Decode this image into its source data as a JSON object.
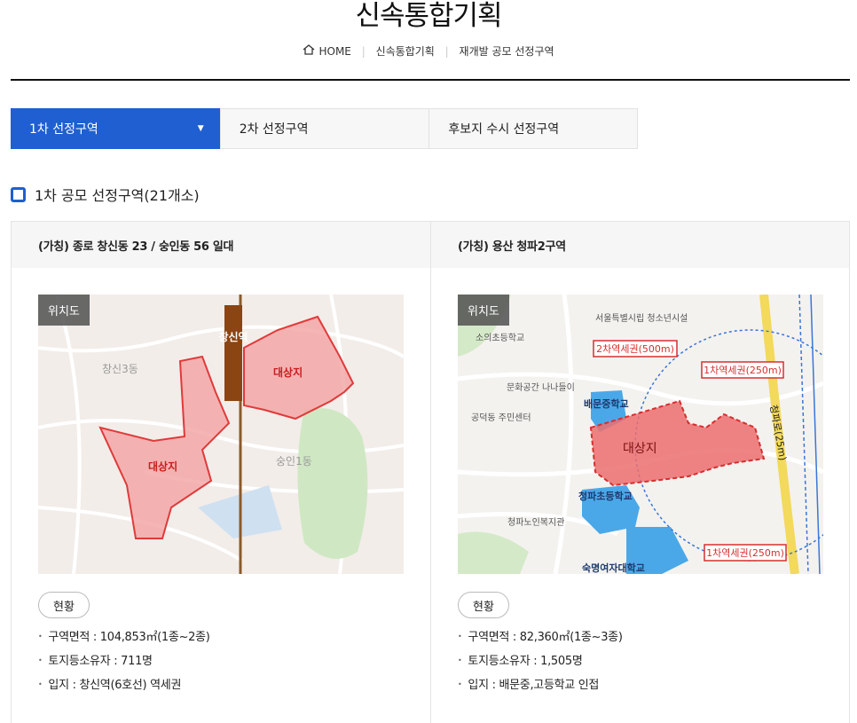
{
  "page": {
    "title": "신속통합기획",
    "breadcrumb": [
      "HOME",
      "신속통합기획",
      "재개발 공모 선정구역"
    ]
  },
  "tabs": [
    {
      "label": "1차 선정구역",
      "active": true
    },
    {
      "label": "2차 선정구역",
      "active": false
    },
    {
      "label": "후보지 수시 선정구역",
      "active": false
    }
  ],
  "section": {
    "title": "1차 공모 선정구역(21개소)",
    "icon": "square-icon"
  },
  "colors": {
    "accent": "#1f5fd1",
    "target_area": "#e85a5a",
    "station_radius": "#d62f2f"
  },
  "cards": [
    {
      "header": "(가칭) 종로 창신동 23 / 숭인동 56 일대",
      "map_label": "위치도",
      "map_texts": {
        "station": "창신역",
        "target1": "대상지",
        "target2": "대상지",
        "district1": "창신3동",
        "district2": "숭인1동"
      },
      "status_label": "현황",
      "info": [
        "구역면적 : 104,853㎡(1종~2종)",
        "토지등소유자 : 711명",
        "입지 : 창신역(6호선) 역세권"
      ]
    },
    {
      "header": "(가칭) 용산 청파2구역",
      "map_label": "위치도",
      "map_texts": {
        "target": "대상지",
        "radius2": "2차역세권(500m)",
        "radius1a": "1차역세권(250m)",
        "radius1b": "1차역세권(250m)",
        "road": "청파로(25m)",
        "school1": "배문중학교",
        "school2": "청파초등학교",
        "school3": "숙명여자대학교",
        "place1": "소의초등학교",
        "place2": "문화공간 나나들이",
        "place3": "공덕동 주민센터",
        "place4": "서울특별시립 청소년시설",
        "place5": "청파노인복지관"
      },
      "status_label": "현황",
      "info": [
        "구역면적 : 82,360㎡(1종~3종)",
        "토지등소유자 : 1,505명",
        "입지 : 배문중,고등학교 인접"
      ]
    }
  ]
}
